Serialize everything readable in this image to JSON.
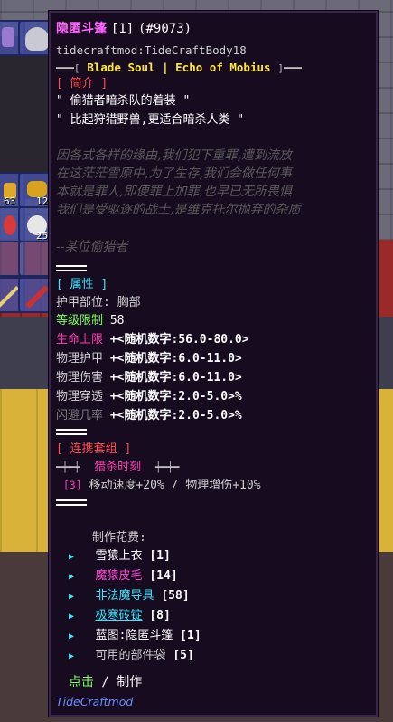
{
  "item": {
    "name": "隐匿斗篷",
    "qty": "[1]",
    "id": "(#9073)",
    "internal_name": "tidecraftmod:TideCraftBody18",
    "soul_banner_left": "━━━[",
    "soul_banner_text": "Blade Soul | Echo of Mobius",
    "soul_banner_right": "]━━━"
  },
  "intro": {
    "header": "[ 简介 ]",
    "quote1": "\" 偷猎者暗杀队的着装 \"",
    "quote2": "\" 比起狩猎野兽,更适合暗杀人类 \"",
    "lore": [
      "因各式各样的缘由,我们犯下重罪,遭到流放",
      "在这茫茫雪原中,为了生存,我们会做任何事",
      "本就是罪人,即便罪上加罪,也早已无所畏惧",
      "我们是受驱逐的战士,是维克托尔抛弃的杂质"
    ],
    "signature": "--某位偷猎者"
  },
  "attributes": {
    "header": "[ 属性 ]",
    "slot_label": "护甲部位:",
    "slot_value": "胸部",
    "level_label": "等级限制",
    "level_value": "58",
    "rows": [
      {
        "label": "生命上限",
        "value": "+<随机数字:56.0-80.0>"
      },
      {
        "label": "物理护甲",
        "value": "+<随机数字:6.0-11.0>"
      },
      {
        "label": "物理伤害",
        "value": "+<随机数字:6.0-11.0>"
      },
      {
        "label": "物理穿透",
        "value": "+<随机数字:2.0-5.0>%"
      },
      {
        "label": "闪避几率",
        "value": "+<随机数字:2.0-5.0>%"
      }
    ]
  },
  "set": {
    "header": "[ 连携套组 ]",
    "left_deco": "━┿━┿",
    "name": "猎杀时刻",
    "right_deco": "┿━┿━",
    "bonus_count": "[3]",
    "bonus_text": "移动速度+20% / 物理增伤+10%"
  },
  "craft": {
    "label": "制作花费:",
    "materials": [
      {
        "name": "雪猿上衣",
        "qty": "[1]"
      },
      {
        "name": "魔猿皮毛",
        "qty": "[14]"
      },
      {
        "name": "非法魔导具",
        "qty": "[58]"
      },
      {
        "name": "极寒砖锭",
        "qty": "[8]"
      },
      {
        "name": "蓝图:隐匿斗篷",
        "qty": "[1]"
      },
      {
        "name": "可用的部件袋",
        "qty": "[5]"
      }
    ]
  },
  "footer": {
    "click": "点击",
    "sep": " / ",
    "make": "制作",
    "mod": "TideCraftmod"
  },
  "inventory": {
    "count_a": "63",
    "count_b": "12",
    "count_c": "25"
  },
  "colors": {
    "tooltip_bg": "#170b20",
    "magenta": "#ff66ff",
    "gold": "#ffe83a",
    "cyan": "#3ee6ff",
    "green": "#7cff5a",
    "pink": "#ff3ab0",
    "red": "#ff4a4a"
  }
}
